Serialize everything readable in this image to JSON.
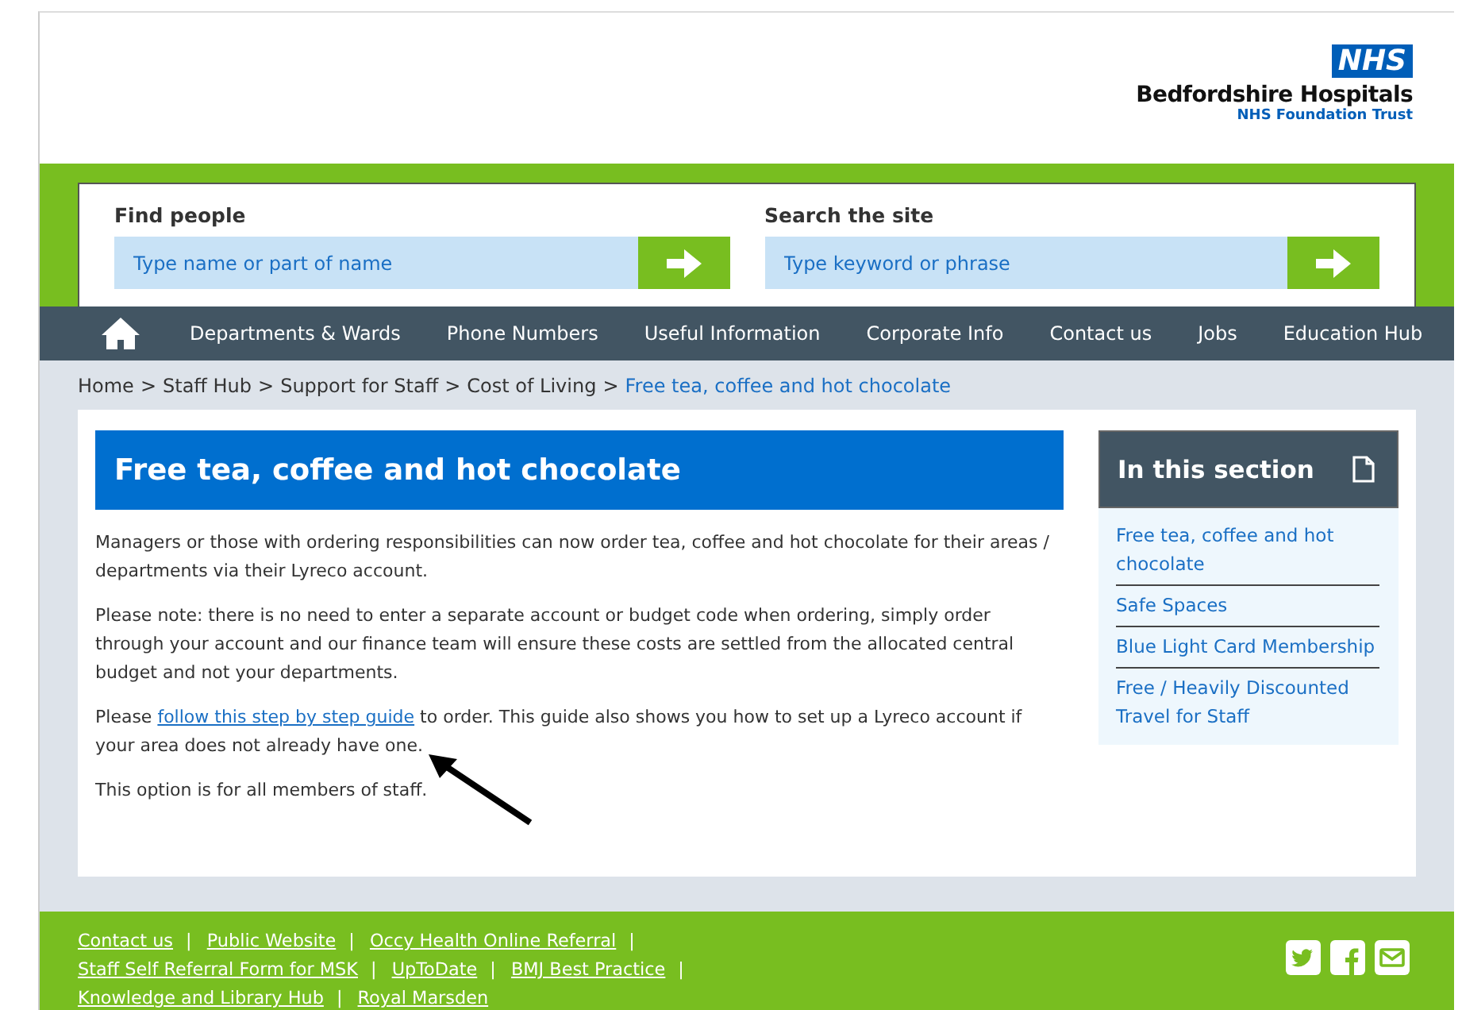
{
  "header": {
    "logo_badge": "NHS",
    "org_name": "Bedfordshire Hospitals",
    "org_sub": "NHS Foundation Trust"
  },
  "search": [
    {
      "label": "Find people",
      "placeholder": "Type name or part of name"
    },
    {
      "label": "Search the site",
      "placeholder": "Type keyword or phrase"
    }
  ],
  "nav": [
    "Departments & Wards",
    "Phone Numbers",
    "Useful Information",
    "Corporate Info",
    "Contact us",
    "Jobs",
    "Education Hub"
  ],
  "breadcrumb": [
    {
      "label": "Home",
      "current": false
    },
    {
      "label": "Staff Hub",
      "current": false
    },
    {
      "label": "Support for Staff",
      "current": false
    },
    {
      "label": "Cost of Living",
      "current": false
    },
    {
      "label": "Free tea, coffee and hot chocolate",
      "current": true
    }
  ],
  "breadcrumb_separator": ">",
  "article": {
    "title": "Free tea, coffee and hot chocolate",
    "paragraphs": [
      {
        "text": "Managers or those with ordering responsibilities can now order tea, coffee and hot chocolate for their areas / departments via their Lyreco account."
      },
      {
        "text": "Please note: there is no need to enter a separate account or budget code when ordering, simply order through your account and our finance team will ensure these costs are settled from the allocated central budget and not your departments."
      },
      {
        "before": "Please ",
        "link": "follow this step by step guide",
        "after": " to order. This guide also shows you how to set up a Lyreco account if your area does not already have one."
      },
      {
        "text": "This option is for all members of staff."
      }
    ]
  },
  "section": {
    "title": "In this section",
    "items": [
      "Free tea, coffee and hot chocolate",
      "Safe Spaces",
      "Blue Light Card Membership",
      "Free / Heavily Discounted Travel for Staff"
    ]
  },
  "footer": {
    "links": [
      {
        "label": "Contact us",
        "separator": "|"
      },
      {
        "label": "Public Website",
        "separator": "|"
      },
      {
        "label": "Occy Health Online Referral",
        "separator": "|"
      },
      {
        "label": "Staff Self Referral Form for MSK",
        "separator": "|"
      },
      {
        "label": "UpToDate",
        "separator": "|"
      },
      {
        "label": "BMJ Best Practice",
        "separator": "|"
      },
      {
        "label": "Knowledge and Library Hub",
        "separator": "|"
      },
      {
        "label": "Royal Marsden"
      }
    ]
  }
}
